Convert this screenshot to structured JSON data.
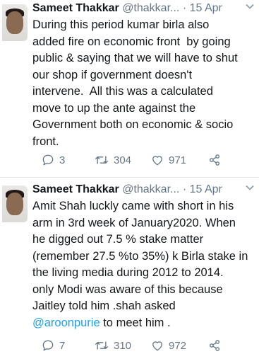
{
  "tweets": [
    {
      "name": "Sameet Thakkar",
      "handle": "@thakkar...",
      "separator": "·",
      "date": "15 Apr",
      "text": "During this period kumar birla also\nadded fire on economic front  by going\npublic & saying that we will have to shut\nour shop if government doesn't\nintervene.  All this was a calculated\nmove to up the ante against the\nGovernment both on economic & socio\nfront.",
      "replies": "3",
      "retweets": "304",
      "likes": "971"
    },
    {
      "name": "Sameet Thakkar",
      "handle": "@thakkar...",
      "separator": "·",
      "date": "15 Apr",
      "text_before_mention": "Amit Shah luckly came with short in his\narm in 3rd week of January2020. When\nhe digged out 7.5 % stake matter\n(remember 27.5 %to 35%) k Birla stake in\nthe living media during 2012 to 2014.\nonly Modi was aware of this because\nJaitley told him .shah asked\n",
      "mention": "@aroonpurie",
      "text_after_mention": " to meet him .",
      "replies": "7",
      "retweets": "310",
      "likes": "972"
    }
  ],
  "icons": {
    "reply": "reply-icon",
    "retweet": "retweet-icon",
    "like": "heart-icon",
    "share": "share-icon",
    "more": "chevron-down-icon"
  },
  "colors": {
    "text": "#14171a",
    "secondary": "#657786",
    "link": "#1da1f2",
    "divider": "#e1e8ed"
  }
}
